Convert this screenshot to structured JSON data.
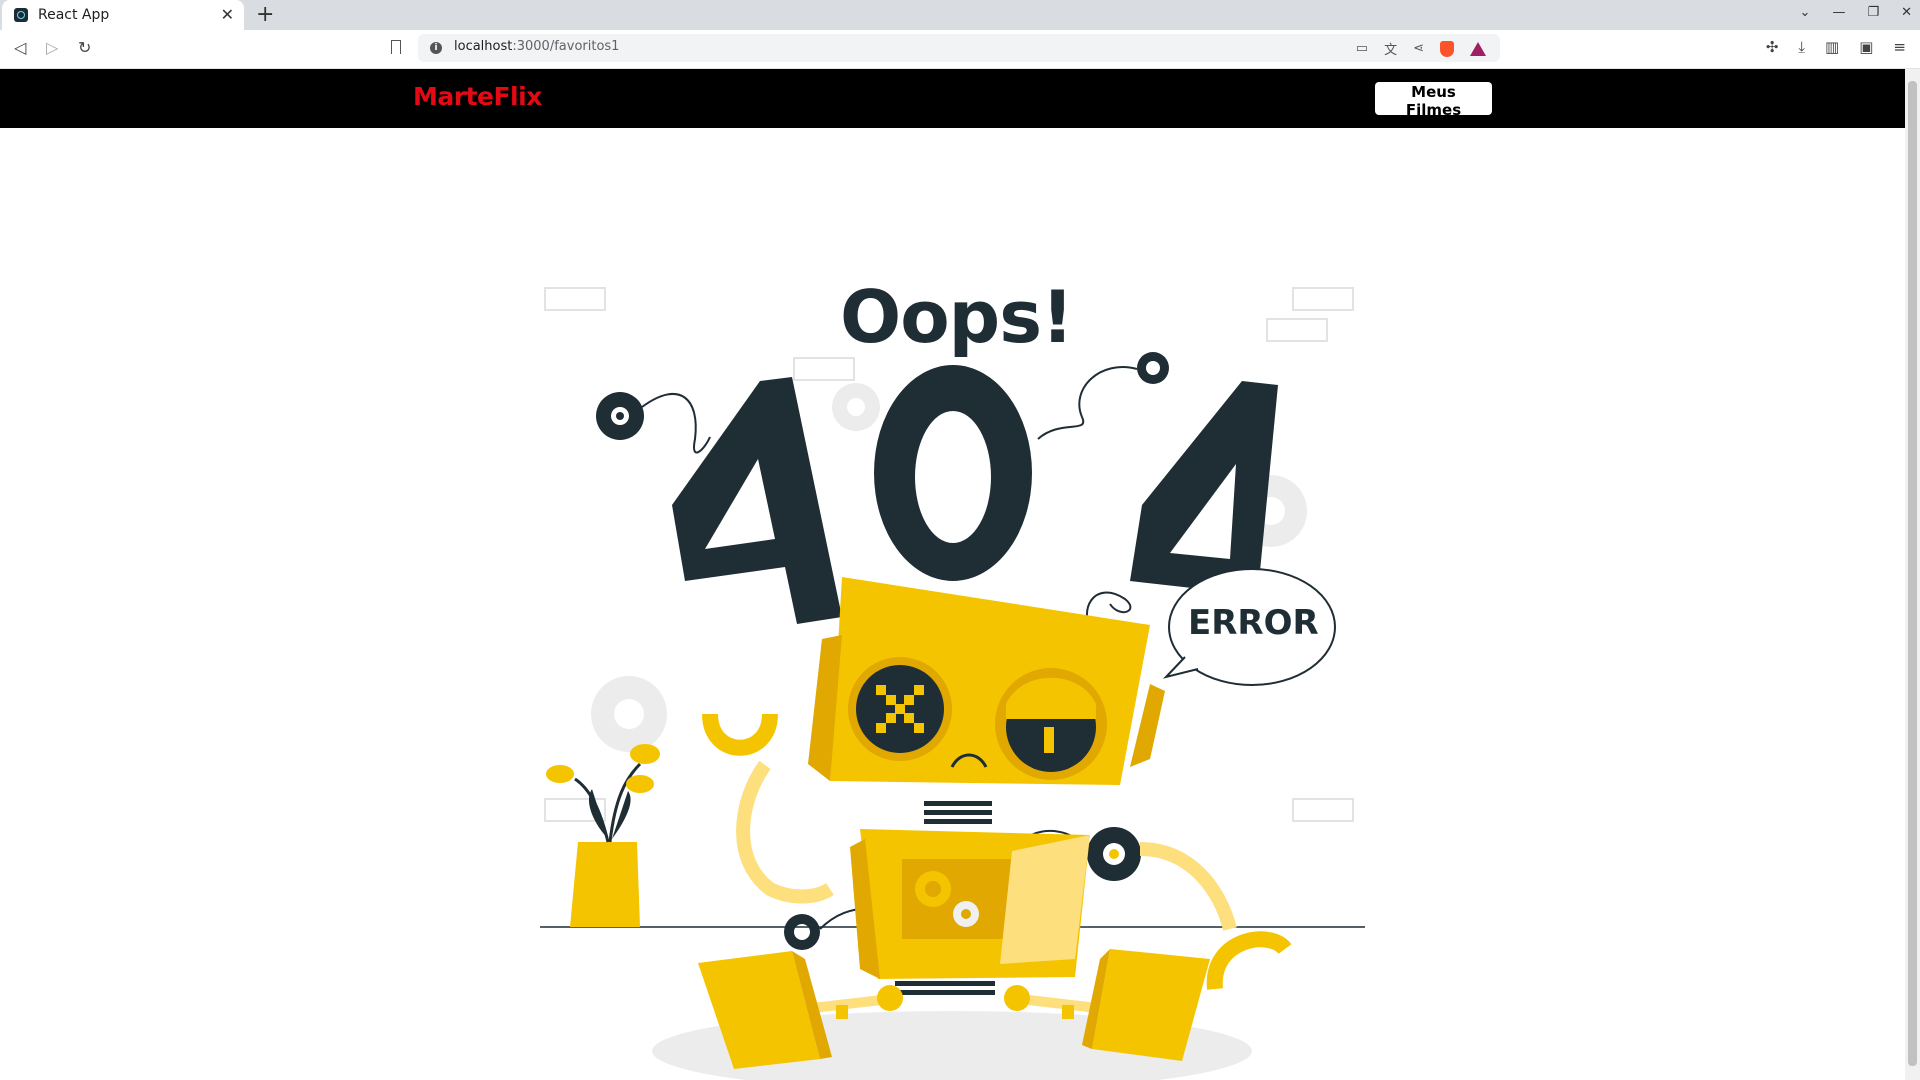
{
  "browser": {
    "tab_title": "React App",
    "url_host": "localhost",
    "url_path": ":3000/favoritos1"
  },
  "header": {
    "logo": "MarteFlix",
    "nav_button": "Meus Filmes"
  },
  "error_page": {
    "headline": "Oops!",
    "code": "404",
    "bubble": "ERROR"
  },
  "colors": {
    "header_bg": "#000000",
    "logo_red": "#e50914",
    "robot_yellow": "#f5c400",
    "dark_text": "#1f2d35"
  }
}
